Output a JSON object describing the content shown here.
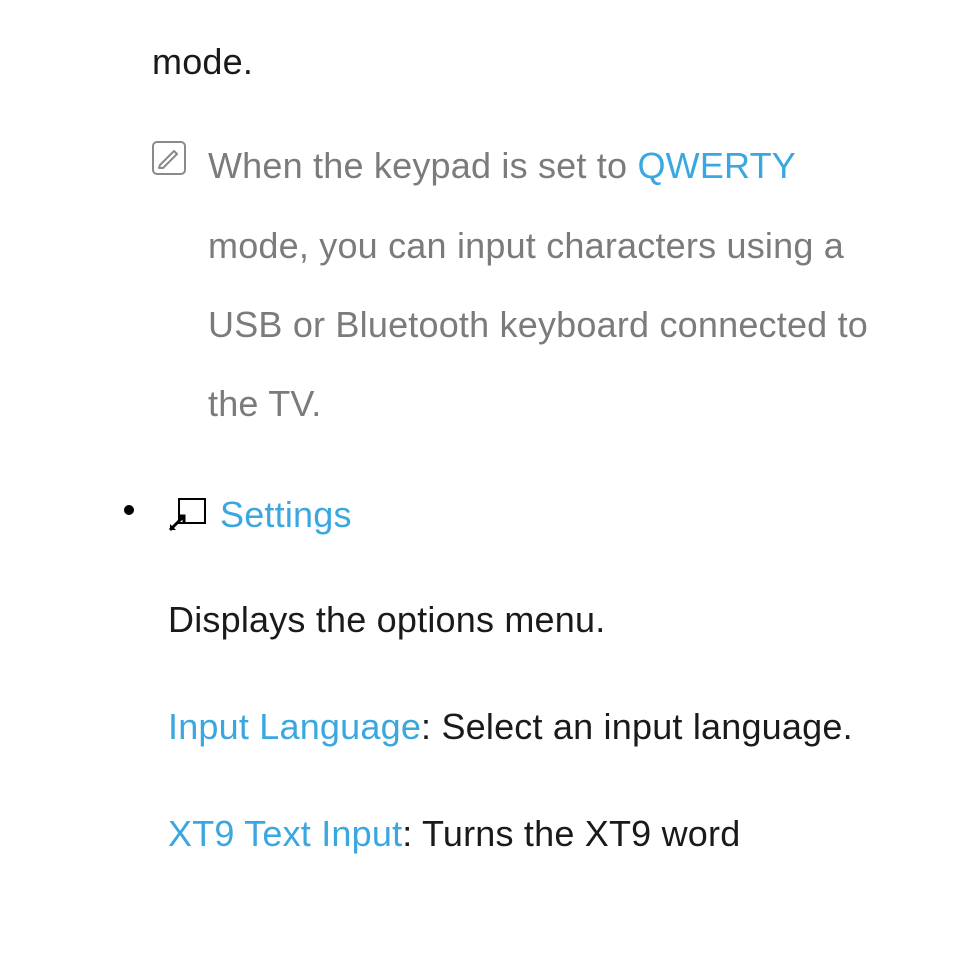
{
  "top": {
    "mode_fragment": "mode."
  },
  "note": {
    "pre": "When the keypad is set to ",
    "qwerty": "QWERTY",
    "post": " mode, you can input characters using a USB or Bluetooth keyboard connected to the TV."
  },
  "bullet": {
    "settings_label": "Settings",
    "desc": "Displays the options menu.",
    "input_language_label": "Input Language",
    "input_language_desc": ": Select an input language.",
    "xt9_label": "XT9 Text Input",
    "xt9_desc": ": Turns the XT9 word"
  }
}
